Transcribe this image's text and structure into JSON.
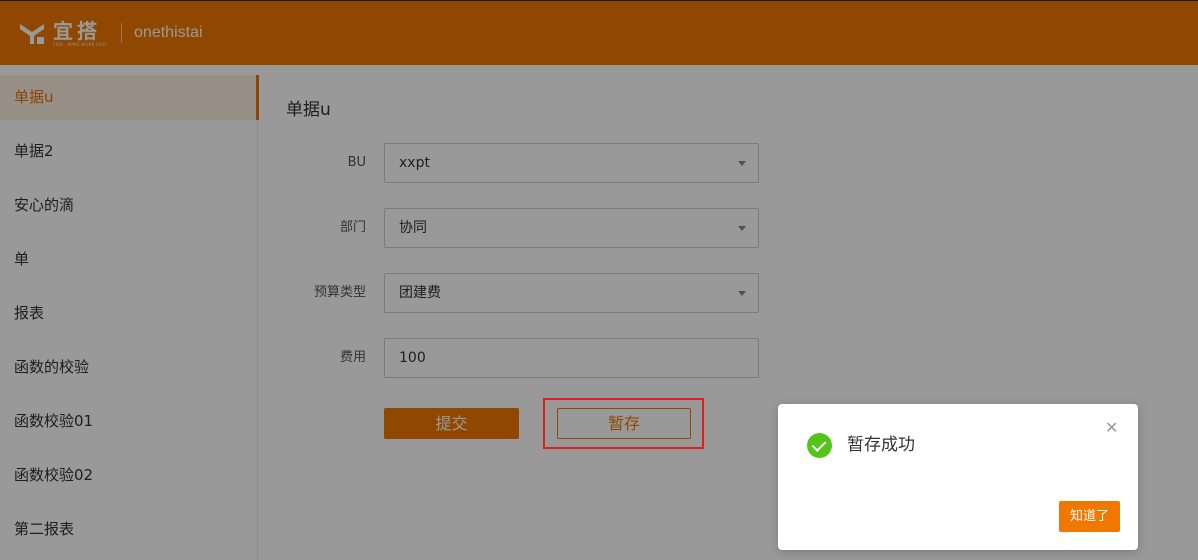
{
  "header": {
    "logo_text": "宜搭",
    "logo_subtext": "YIDA · MAKE WORK EASY",
    "app_name": "onethistai",
    "colors": {
      "primary": "#F07800"
    }
  },
  "sidebar": {
    "items": [
      {
        "label": "单据u",
        "active": true
      },
      {
        "label": "单据2"
      },
      {
        "label": "安心的滴"
      },
      {
        "label": "单"
      },
      {
        "label": "报表"
      },
      {
        "label": "函数的校验"
      },
      {
        "label": "函数校验01"
      },
      {
        "label": "函数校验02"
      },
      {
        "label": "第二报表"
      }
    ]
  },
  "form": {
    "title": "单据u",
    "fields": [
      {
        "label": "BU",
        "value": "xxpt",
        "type": "select"
      },
      {
        "label": "部门",
        "value": "协同",
        "type": "select"
      },
      {
        "label": "预算类型",
        "value": "团建费",
        "type": "select"
      },
      {
        "label": "费用",
        "value": "100",
        "type": "input"
      }
    ],
    "submit_label": "提交",
    "save_label": "暂存"
  },
  "toast": {
    "message": "暂存成功",
    "close_glyph": "✕",
    "confirm_label": "知道了",
    "icon": "check-circle-icon",
    "status_color": "#52c41a"
  }
}
